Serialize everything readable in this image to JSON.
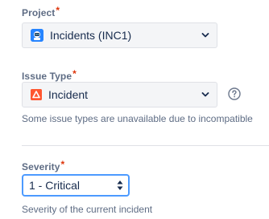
{
  "project": {
    "label": "Project",
    "required_mark": "*",
    "value": "Incidents (INC1)",
    "icon": "project-avatar-icon"
  },
  "issue_type": {
    "label": "Issue Type",
    "required_mark": "*",
    "value": "Incident",
    "icon": "incident-issue-type-icon",
    "helper_text": "Some issue types are unavailable due to incompatible"
  },
  "severity": {
    "label": "Severity",
    "required_mark": "*",
    "value": "1 - Critical",
    "helper_text": "Severity of the current incident"
  },
  "colors": {
    "required": "#de350b",
    "focus_border": "#4c9aff",
    "project_icon": "#2684ff",
    "incident_icon": "#ff5630"
  }
}
